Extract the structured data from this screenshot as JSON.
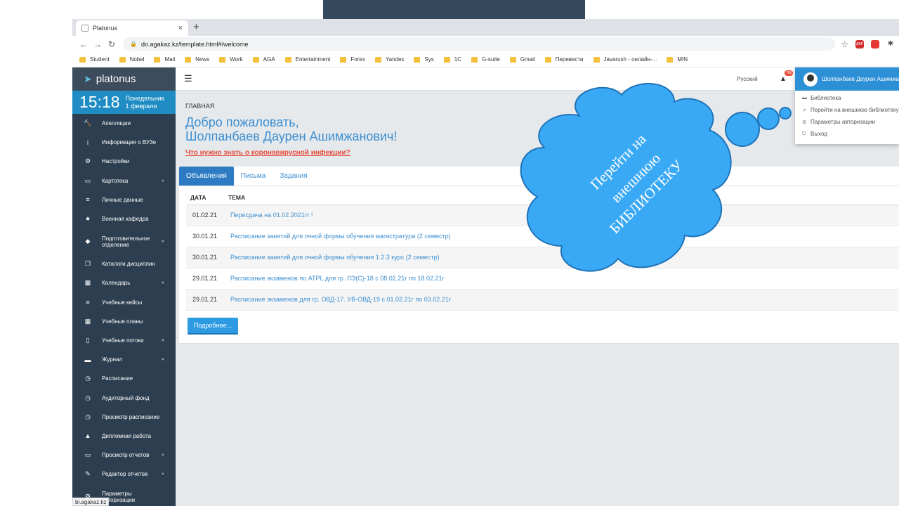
{
  "browser": {
    "tab_title": "Platonus",
    "new_tab_symbol": "+",
    "url": "do.agakaz.kz/template.html#/welcome",
    "bookmarks": [
      "Student",
      "Nobel",
      "Mail",
      "News",
      "Work",
      "AGA",
      "Entertainment",
      "Forex",
      "Yandex",
      "Sys",
      "1C",
      "G-suite",
      "Gmail",
      "Перевести",
      "Javarush - онлайн-...",
      "MIN"
    ],
    "adblock_badge": "ABP",
    "status_url": "bi.agakaz.kz"
  },
  "sidebar": {
    "brand": "platonus",
    "time": "15:18",
    "day": "Понедельник",
    "date": "1 февраля",
    "items": [
      {
        "label": "Апелляции",
        "icon": "gavel-icon"
      },
      {
        "label": "Информация о ВУЗе",
        "icon": "info-icon"
      },
      {
        "label": "Настройки",
        "icon": "gears-icon"
      },
      {
        "label": "Картотека",
        "icon": "folder-icon",
        "arrow": true
      },
      {
        "label": "Личные данные",
        "icon": "list-icon"
      },
      {
        "label": "Военная кафедра",
        "icon": "star-icon"
      },
      {
        "label": "Подготовительное отделение",
        "icon": "cube-icon",
        "arrow": true
      },
      {
        "label": "Каталоги дисциплин",
        "icon": "copy-icon"
      },
      {
        "label": "Календарь",
        "icon": "calendar-icon",
        "arrow": true
      },
      {
        "label": "Учебные кейсы",
        "icon": "list-icon"
      },
      {
        "label": "Учебные планы",
        "icon": "grid-icon"
      },
      {
        "label": "Учебные потоки",
        "icon": "file-icon",
        "arrow": true
      },
      {
        "label": "Журнал",
        "icon": "book-icon",
        "arrow": true
      },
      {
        "label": "Расписание",
        "icon": "clock-icon"
      },
      {
        "label": "Аудиторный фонд",
        "icon": "clock-icon"
      },
      {
        "label": "Просмотр расписание",
        "icon": "clock-icon"
      },
      {
        "label": "Дипломная работа",
        "icon": "graduation-cap-icon"
      },
      {
        "label": "Просмотр отчетов",
        "icon": "card-icon",
        "arrow": true
      },
      {
        "label": "Редактор отчетов",
        "icon": "edit-icon",
        "arrow": true
      },
      {
        "label": "Параметры авторизации",
        "icon": "gear-icon"
      }
    ]
  },
  "header": {
    "menu_icon": "hamburger-icon",
    "language": "Русский",
    "notification_count": "766"
  },
  "main": {
    "breadcrumb": "ГЛАВНАЯ",
    "welcome_line1": "Добро пожаловать,",
    "welcome_line2": "Шолпанбаев Даурен Ашимжанович!",
    "covid_link": "Что нужно знать о коронавирусной инфекции?",
    "tabs": [
      "Объявления",
      "Письма",
      "Задания"
    ],
    "columns": [
      "ДАТА",
      "ТЕМА"
    ],
    "rows": [
      {
        "date": "01.02.21",
        "topic": "Пересдача на 01.02.2021гг !"
      },
      {
        "date": "30.01.21",
        "topic": "Расписание занятий для очной формы обучения магистратура (2 семестр)"
      },
      {
        "date": "30.01.21",
        "topic": "Расписание занятий для очной формы обучения 1.2.3 курс (2 семестр)"
      },
      {
        "date": "29.01.21",
        "topic": "Расписание экзаменов по ATPL для гр. ЛЭ(С)-18 с 08.02.21г по 18.02.21г"
      },
      {
        "date": "29.01.21",
        "topic": "Расписание экзаменов для гр. ОВД-17. УВ-ОВД-19 с 01.02.21г по 03.02.21г"
      }
    ],
    "more_button": "Подробнее..."
  },
  "user_menu": {
    "name": "Шолпанбаев Даурен Ашимжанович",
    "items": [
      {
        "label": "Библиотека",
        "icon": "book-icon"
      },
      {
        "label": "Перейти на внешнюю библиотеку",
        "icon": "external-link-icon"
      },
      {
        "label": "Параметры авторизации",
        "icon": "gear-icon"
      },
      {
        "label": "Выход",
        "icon": "power-icon"
      }
    ]
  },
  "callout": {
    "line1": "Перейти на",
    "line2": "внешнюю",
    "line3": "БИБЛИОТЕКУ",
    "color": "#3aa9f5"
  }
}
